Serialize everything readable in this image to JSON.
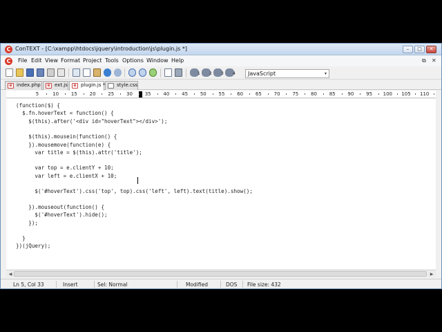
{
  "window": {
    "title": "ConTEXT - [C:\\xampp\\htdocs\\jquery\\introduction\\js\\plugin.js *]",
    "app_logo": "C",
    "controls": {
      "minimize": "–",
      "restore": "□",
      "close": "✕"
    }
  },
  "menu": {
    "items": [
      "File",
      "Edit",
      "View",
      "Format",
      "Project",
      "Tools",
      "Options",
      "Window",
      "Help"
    ],
    "mdi_restore": "⧉",
    "mdi_close": "✕"
  },
  "toolbar": {
    "language_select": "JavaScript",
    "language_arrow": "▾",
    "icons": [
      "new-file-icon",
      "open-folder-icon",
      "save-icon",
      "save-all-icon",
      "print-icon",
      "print-preview-icon",
      "cut-icon",
      "copy-icon",
      "paste-icon",
      "undo-icon",
      "redo-icon",
      "find-icon",
      "find-next-icon",
      "replace-icon",
      "file-compare-icon",
      "tools-icon",
      "user-command-1-icon",
      "user-command-2-icon",
      "user-command-3-icon",
      "user-command-4-icon"
    ],
    "user_command_labels": [
      "1",
      "2",
      "3",
      "4"
    ]
  },
  "tabs": [
    {
      "label": "index.php",
      "icon": "php-file-icon",
      "active": false
    },
    {
      "label": "ext.js",
      "icon": "js-file-icon",
      "active": false
    },
    {
      "label": "plugin.js *",
      "icon": "js-file-icon",
      "active": true
    },
    {
      "label": "style.css",
      "icon": "css-file-icon",
      "active": false
    }
  ],
  "ruler": {
    "labels": [
      "5",
      "10",
      "15",
      "20",
      "25",
      "30",
      "35",
      "40",
      "45",
      "50",
      "55",
      "60",
      "65",
      "70",
      "75",
      "80",
      "85",
      "90",
      "95",
      "100",
      "105",
      "110"
    ]
  },
  "code": [
    "(function($) {",
    "  $.fn.hoverText = function() {",
    "    $(this).after('<div id=\"hoverText\"></div>');",
    "",
    "    $(this).mousein(function() {",
    "    }).mousemove(function(e) {",
    "      var title = $(this).attr('title');",
    "",
    "      var top = e.clientY + 10;",
    "      var left = e.clientX + 10;",
    "",
    "      $('#hoverText').css('top', top).css('left', left).text(title).show();",
    "",
    "    }).mouseout(function() {",
    "      $('#hoverText').hide();",
    "    });",
    "",
    "  }",
    "})(jQuery);"
  ],
  "status": {
    "position": "Ln 5, Col 33",
    "insert_mode": "Insert",
    "selection_mode": "Sel: Normal",
    "modified": "Modified",
    "line_endings": "DOS",
    "file_size": "File size: 432"
  }
}
